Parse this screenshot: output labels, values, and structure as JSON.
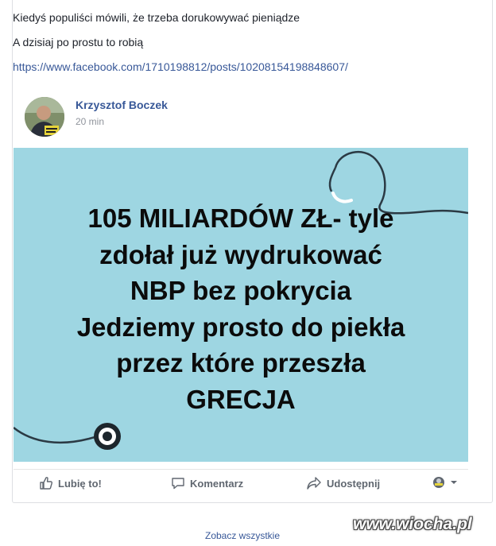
{
  "post": {
    "line1": "Kiedyś populiści mówili, że trzeba dorukowywać pieniądze",
    "line2": "A dzisiaj po prostu to robią",
    "link": "https://www.facebook.com/1710198812/posts/10208154198848607/"
  },
  "shared_post": {
    "author": "Krzysztof Boczek",
    "time": "20 min",
    "image_lines": [
      "105 MILIARDÓW ZŁ- tyle",
      "zdołał już wydrukować",
      "NBP bez pokrycia",
      "Jedziemy prosto do piekła",
      "przez które przeszła",
      "GRECJA"
    ],
    "image_background": "#9ed6e2"
  },
  "actions": {
    "like": "Lubię to!",
    "comment": "Komentarz",
    "share": "Udostępnij"
  },
  "footer": {
    "see_all": "Zobacz wszystkie"
  },
  "watermark": "www.wiocha.pl",
  "colors": {
    "link": "#385898",
    "muted": "#90949c",
    "action": "#606770"
  }
}
